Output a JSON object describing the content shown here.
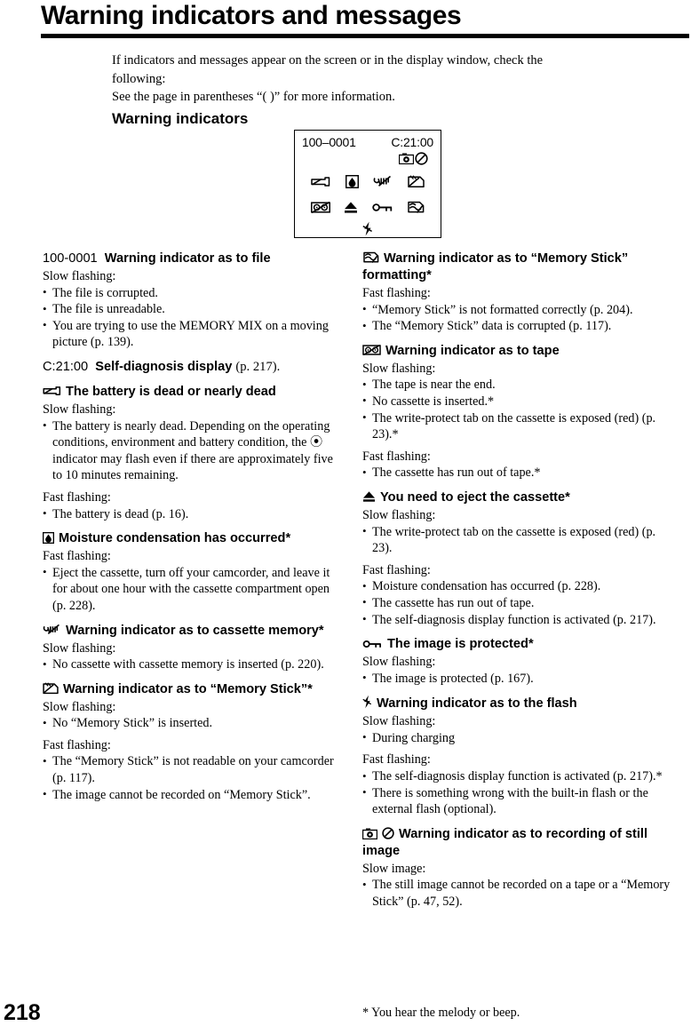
{
  "page": {
    "title": "Warning indicators and messages",
    "number": "218",
    "footnote": "* You hear the melody or beep."
  },
  "intro": {
    "line1": "If indicators and messages appear on the screen or in the display window, check the",
    "line2": "following:",
    "line3": "See the page in parentheses “(   )” for more information."
  },
  "section_heading": "Warning indicators",
  "lcd": {
    "file_code": "100–0001",
    "diag_code": "C:21:00",
    "icons_row_nostill": [
      "camera-icon",
      "no-symbol-icon"
    ],
    "icons_row_1": [
      "battery-low-icon",
      "moisture-icon",
      "cassette-memory-icon",
      "memory-stick-icon"
    ],
    "icons_row_2": [
      "tape-icon",
      "eject-icon",
      "key-protect-icon",
      "memory-stick-format-icon"
    ],
    "icons_row_3": [
      "flash-icon"
    ]
  },
  "entries": {
    "left": [
      {
        "icon": "none",
        "code": "100-0001",
        "title": "Warning indicator as to file",
        "groups": [
          {
            "label": "Slow flashing:",
            "items": [
              "The file is corrupted.",
              "The file is unreadable.",
              "You are trying to use the MEMORY MIX on a moving picture (p. 139)."
            ]
          }
        ]
      },
      {
        "icon": "none",
        "code": "C:21:00",
        "title": "Self-diagnosis display",
        "tail": "(p. 217).",
        "groups": []
      },
      {
        "icon": "battery-low-icon",
        "title": "The battery is dead or nearly dead",
        "groups": [
          {
            "label": "Slow flashing:",
            "items": [
              "The battery is nearly dead. Depending on the operating conditions, environment and battery condition, the ⦿ indicator may flash even if there are approximately five to 10 minutes remaining."
            ],
            "inline_icon_item": 0
          },
          {
            "label": "Fast flashing:",
            "items": [
              "The battery is dead (p. 16)."
            ]
          }
        ]
      },
      {
        "icon": "moisture-icon",
        "title": "Moisture condensation has occurred*",
        "groups": [
          {
            "label": "Fast flashing:",
            "items": [
              "Eject the cassette, turn off your camcorder, and leave it for about one hour with the cassette compartment open (p. 228)."
            ]
          }
        ]
      },
      {
        "icon": "cassette-memory-icon",
        "title": "Warning indicator as to cassette memory*",
        "groups": [
          {
            "label": "Slow flashing:",
            "items": [
              "No cassette with cassette memory is inserted (p. 220)."
            ]
          }
        ]
      },
      {
        "icon": "memory-stick-icon",
        "title": "Warning indicator as to “Memory Stick”*",
        "groups": [
          {
            "label": "Slow flashing:",
            "items": [
              "No “Memory Stick” is inserted."
            ]
          },
          {
            "label": "Fast flashing:",
            "items": [
              "The “Memory Stick” is not readable on your camcorder (p. 117).",
              "The image cannot be recorded on “Memory Stick”."
            ]
          }
        ]
      }
    ],
    "right": [
      {
        "icon": "memory-stick-format-icon",
        "title": "Warning indicator as to “Memory Stick” formatting*",
        "groups": [
          {
            "label": "Fast flashing:",
            "items": [
              "“Memory Stick” is not formatted correctly (p. 204).",
              "The “Memory Stick” data is corrupted (p. 117)."
            ]
          }
        ]
      },
      {
        "icon": "tape-icon",
        "title": "Warning indicator as to tape",
        "groups": [
          {
            "label": "Slow flashing:",
            "items": [
              "The tape is near the end.",
              "No cassette is inserted.*",
              "The write-protect tab on the cassette is exposed (red) (p. 23).*"
            ]
          },
          {
            "label": "Fast flashing:",
            "items": [
              "The cassette has run out of tape.*"
            ]
          }
        ]
      },
      {
        "icon": "eject-icon",
        "title": "You need to eject the cassette*",
        "groups": [
          {
            "label": "Slow flashing:",
            "items": [
              "The write-protect tab on the cassette is exposed (red) (p. 23)."
            ]
          },
          {
            "label": "Fast flashing:",
            "items": [
              "Moisture condensation has occurred (p. 228).",
              "The cassette has run out of tape.",
              "The self-diagnosis display function is activated (p. 217)."
            ]
          }
        ]
      },
      {
        "icon": "key-protect-icon",
        "title": "The image is protected*",
        "groups": [
          {
            "label": "Slow flashing:",
            "items": [
              "The image is protected (p. 167)."
            ]
          }
        ]
      },
      {
        "icon": "flash-icon",
        "title": "Warning indicator as to the flash",
        "groups": [
          {
            "label": "Slow flashing:",
            "items": [
              "During charging"
            ]
          },
          {
            "label": "Fast flashing:",
            "items": [
              "The self-diagnosis display function is activated (p. 217).*",
              "There is something wrong with the built-in flash or the external flash (optional)."
            ]
          }
        ]
      },
      {
        "icon": "camera-no-icon",
        "title": "Warning indicator as to recording of still image",
        "groups": [
          {
            "label": "Slow image:",
            "items": [
              "The still image cannot be recorded on a tape or a “Memory Stick” (p. 47, 52)."
            ]
          }
        ]
      }
    ]
  }
}
